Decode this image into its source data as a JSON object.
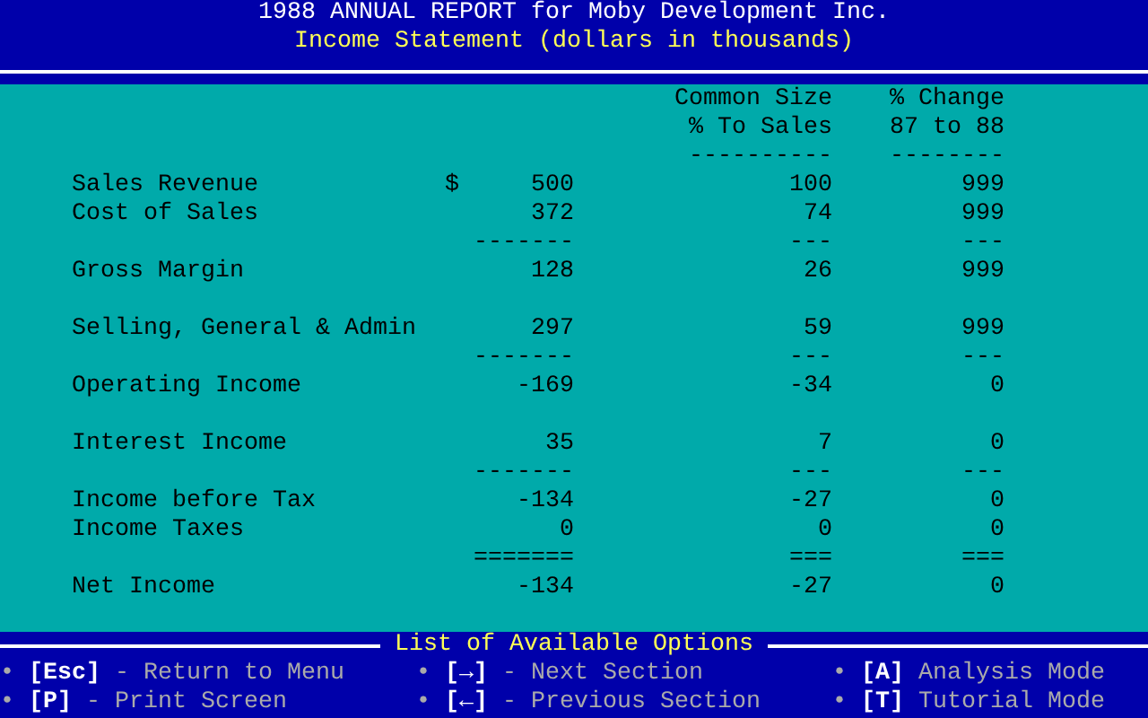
{
  "header": {
    "title": "1988 ANNUAL REPORT for Moby Development Inc.",
    "subtitle": "Income Statement (dollars in thousands)"
  },
  "statement": {
    "columns": [
      {
        "line1": "Common Size",
        "line2": "% To Sales",
        "rule": "----------"
      },
      {
        "line1": "% Change",
        "line2": "87 to 88",
        "rule": "--------"
      }
    ],
    "lines": [
      {
        "kind": "item",
        "label": "Sales Revenue",
        "currency": "$",
        "amount": "500",
        "common_size": "100",
        "change": "999"
      },
      {
        "kind": "item",
        "label": "Cost of Sales",
        "amount": "372",
        "common_size": "74",
        "change": "999"
      },
      {
        "kind": "rule",
        "amount": "-------",
        "common_size": "---",
        "change": "---"
      },
      {
        "kind": "item",
        "label": "Gross Margin",
        "amount": "128",
        "common_size": "26",
        "change": "999"
      },
      {
        "kind": "blank"
      },
      {
        "kind": "item",
        "label": "Selling, General & Admin",
        "amount": "297",
        "common_size": "59",
        "change": "999"
      },
      {
        "kind": "rule",
        "amount": "-------",
        "common_size": "---",
        "change": "---"
      },
      {
        "kind": "item",
        "label": "Operating Income",
        "amount": "-169",
        "common_size": "-34",
        "change": "0"
      },
      {
        "kind": "blank"
      },
      {
        "kind": "item",
        "label": "Interest Income",
        "amount": "35",
        "common_size": "7",
        "change": "0"
      },
      {
        "kind": "rule",
        "amount": "-------",
        "common_size": "---",
        "change": "---"
      },
      {
        "kind": "item",
        "label": "Income before Tax",
        "amount": "-134",
        "common_size": "-27",
        "change": "0"
      },
      {
        "kind": "item",
        "label": "Income Taxes",
        "amount": "0",
        "common_size": "0",
        "change": "0"
      },
      {
        "kind": "rule",
        "amount": "=======",
        "common_size": "===",
        "change": "==="
      },
      {
        "kind": "item",
        "label": "Net Income",
        "amount": "-134",
        "common_size": "-27",
        "change": "0"
      }
    ]
  },
  "options": {
    "title": "List of Available Options",
    "items": [
      {
        "bullet": "•",
        "key": "[Esc]",
        "text": "- Return to Menu"
      },
      {
        "bullet": "•",
        "key": "[→]",
        "text": "- Next Section"
      },
      {
        "bullet": "•",
        "key": "[A]",
        "text": "Analysis Mode"
      },
      {
        "bullet": "•",
        "key": "[P]",
        "text": "- Print Screen"
      },
      {
        "bullet": "•",
        "key": "[←]",
        "text": "- Previous Section"
      },
      {
        "bullet": "•",
        "key": "[T]",
        "text": "Tutorial Mode"
      }
    ]
  }
}
